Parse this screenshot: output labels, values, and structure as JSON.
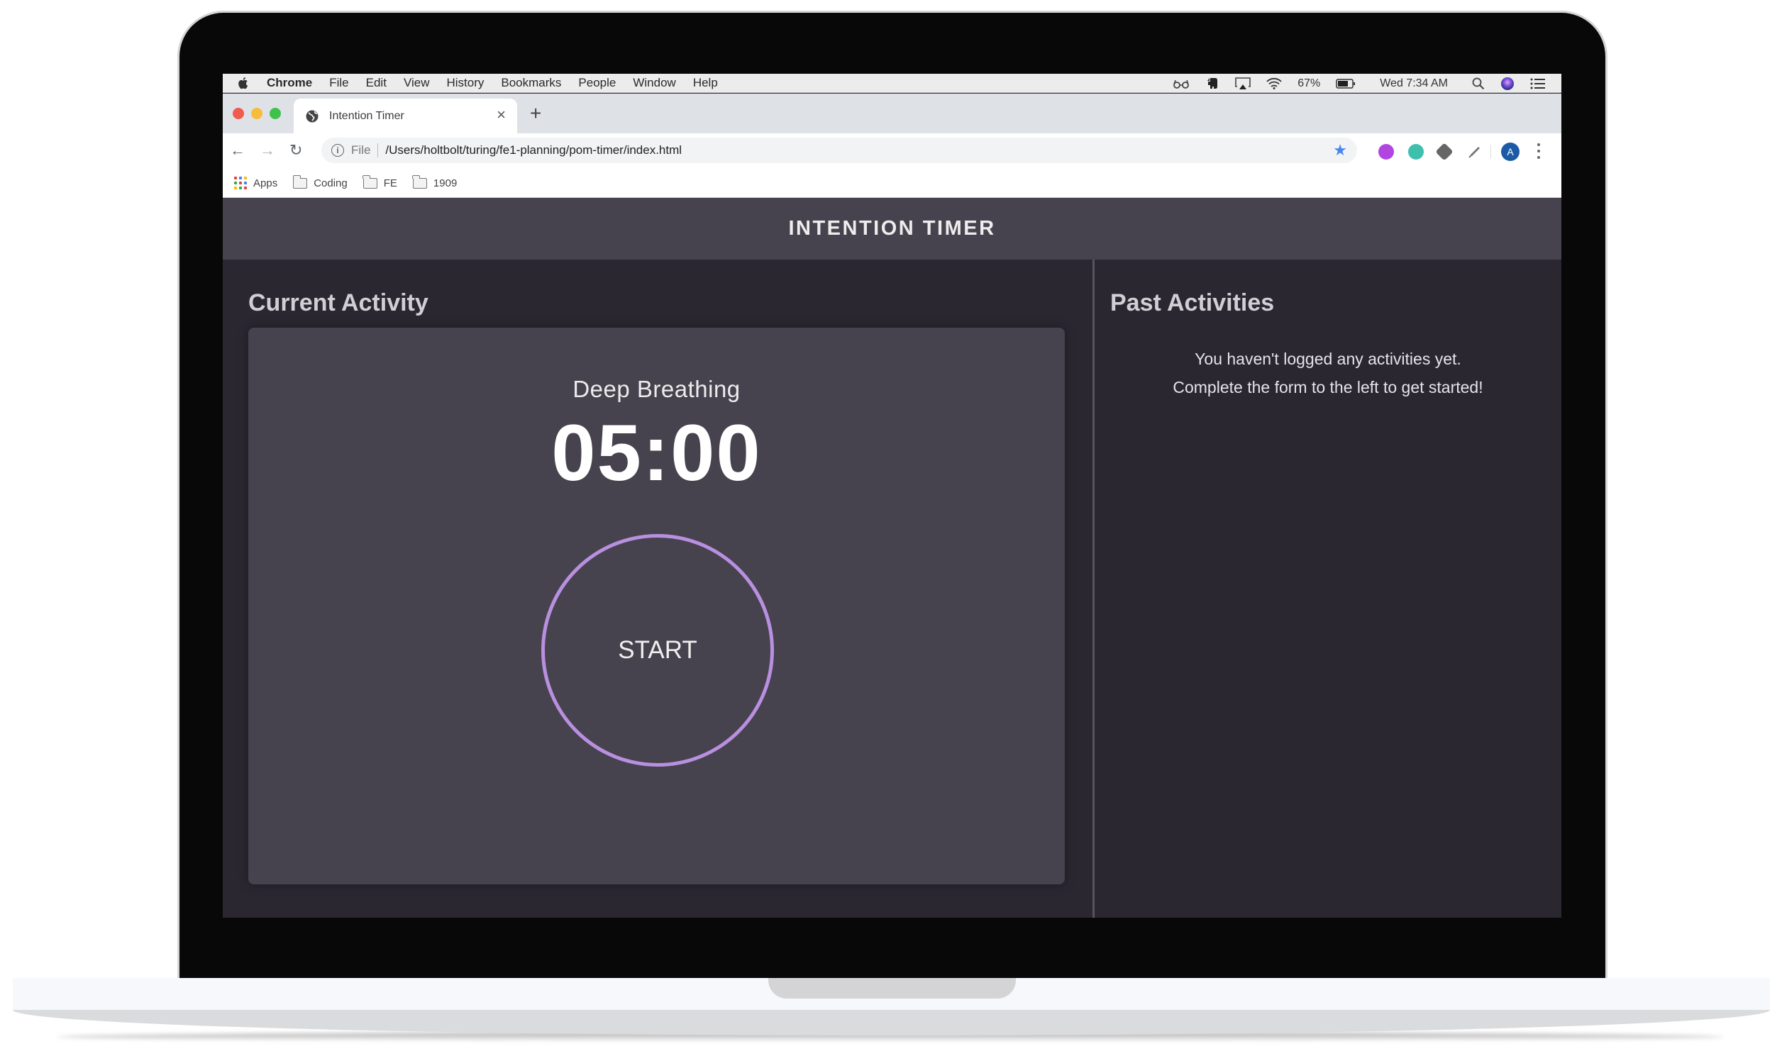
{
  "menubar": {
    "items": [
      {
        "label": "Chrome",
        "bold": true
      },
      {
        "label": "File"
      },
      {
        "label": "Edit"
      },
      {
        "label": "View"
      },
      {
        "label": "History"
      },
      {
        "label": "Bookmarks"
      },
      {
        "label": "People"
      },
      {
        "label": "Window"
      },
      {
        "label": "Help"
      }
    ],
    "status": {
      "battery_percent": "67%",
      "clock": "Wed 7:34 AM"
    }
  },
  "browser": {
    "tab": {
      "title": "Intention Timer",
      "close_glyph": "×"
    },
    "new_tab_glyph": "+",
    "address": {
      "scheme_label": "File",
      "url": "/Users/holtbolt/turing/fe1-planning/pom-timer/index.html"
    },
    "nav": {
      "back": "←",
      "forward": "→",
      "reload": "↻",
      "bookmark_star": "★"
    },
    "profile_initial": "A",
    "bookmarks": [
      {
        "label": "Apps",
        "icon": "apps-grid-icon"
      },
      {
        "label": "Coding",
        "icon": "folder-icon"
      },
      {
        "label": "FE",
        "icon": "folder-icon"
      },
      {
        "label": "1909",
        "icon": "folder-icon"
      }
    ]
  },
  "app": {
    "title": "INTENTION TIMER",
    "current": {
      "heading": "Current Activity",
      "activity_name": "Deep Breathing",
      "time_remaining": "05:00",
      "start_label": "START"
    },
    "past": {
      "heading": "Past Activities",
      "empty_line1": "You haven't logged any activities yet.",
      "empty_line2": "Complete the form to the left to get started!"
    }
  },
  "colors": {
    "header_bg": "#46434e",
    "panel_bg": "#2a2731",
    "card_bg": "#46434e",
    "start_ring": "#b98fe0"
  }
}
